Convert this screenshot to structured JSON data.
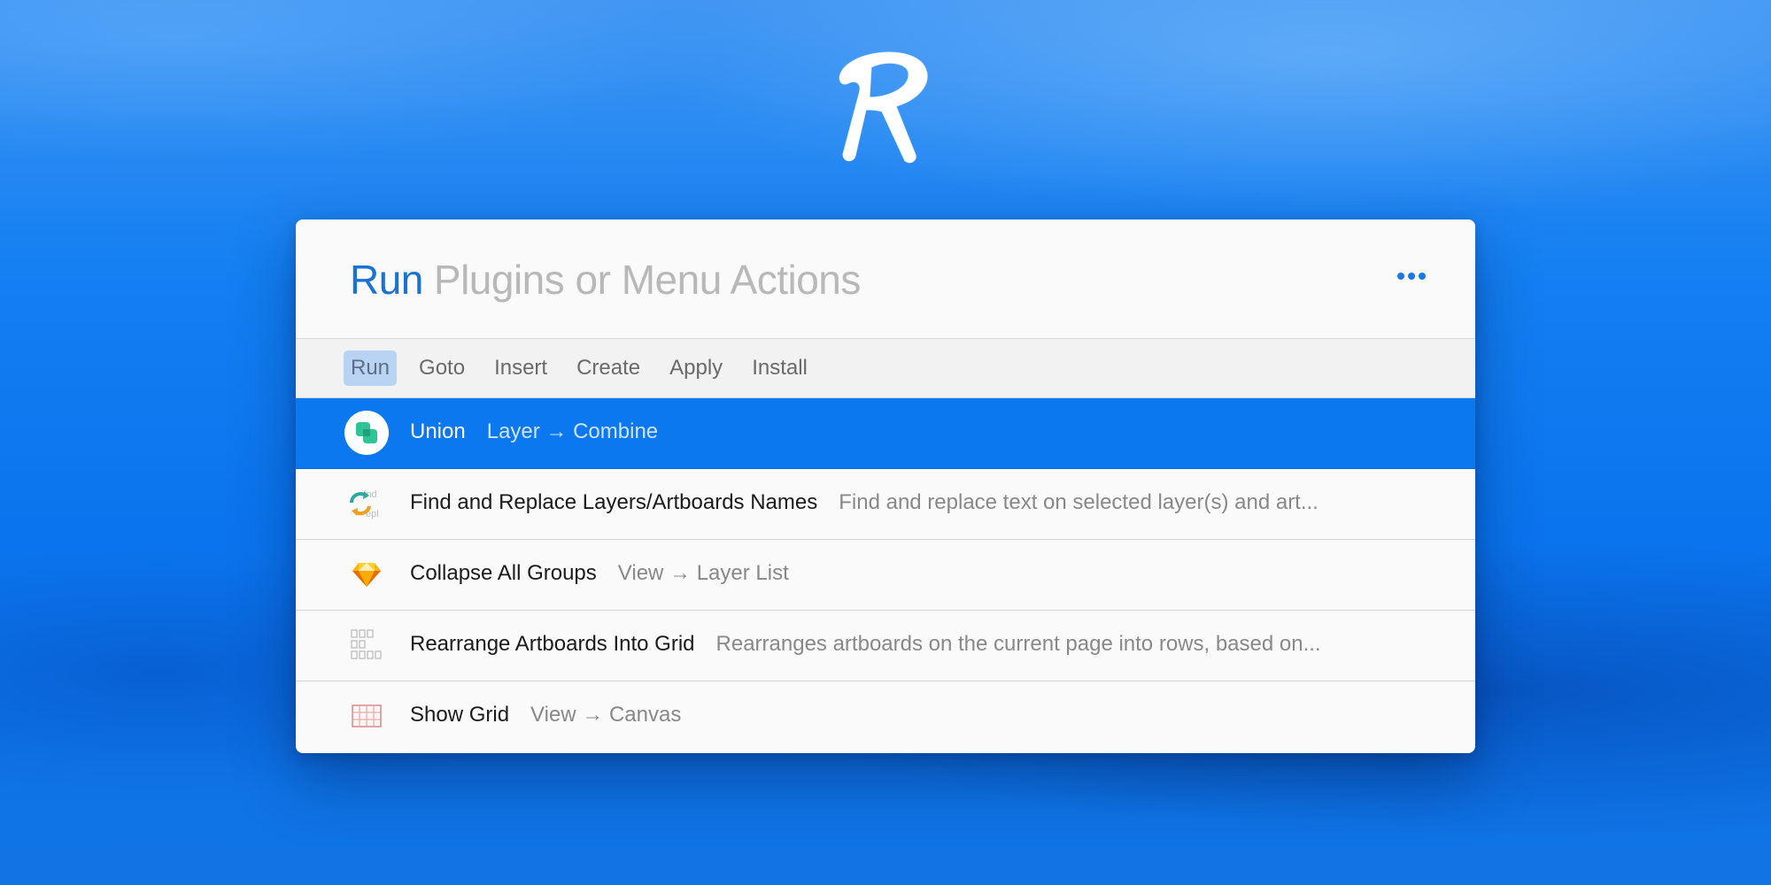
{
  "search": {
    "keyword": "Run",
    "placeholder": "Plugins or Menu Actions"
  },
  "tabs": [
    {
      "label": "Run",
      "active": true
    },
    {
      "label": "Goto",
      "active": false
    },
    {
      "label": "Insert",
      "active": false
    },
    {
      "label": "Create",
      "active": false
    },
    {
      "label": "Apply",
      "active": false
    },
    {
      "label": "Install",
      "active": false
    }
  ],
  "results": [
    {
      "title": "Union",
      "subtitle": "Layer → Combine",
      "icon": "union-icon",
      "selected": true
    },
    {
      "title": "Find and Replace Layers/Artboards Names",
      "subtitle": "Find and replace text on selected layer(s) and art...",
      "icon": "find-replace-icon",
      "selected": false
    },
    {
      "title": "Collapse All Groups",
      "subtitle": "View → Layer List",
      "icon": "sketch-diamond-icon",
      "selected": false
    },
    {
      "title": "Rearrange Artboards Into Grid",
      "subtitle": "Rearranges artboards on the current page into rows, based on...",
      "icon": "artboard-grid-icon",
      "selected": false
    },
    {
      "title": "Show Grid",
      "subtitle": "View → Canvas",
      "icon": "grid-icon",
      "selected": false
    }
  ],
  "colors": {
    "accent": "#0b78f0",
    "keyword": "#1a73d4",
    "background": "#1480f2"
  }
}
